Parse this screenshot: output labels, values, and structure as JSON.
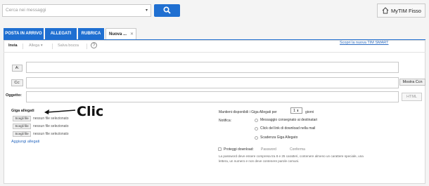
{
  "top": {
    "search_placeholder": "Cerca nei messaggi",
    "mytim_label": "MyTIM Fisso"
  },
  "tabs": [
    {
      "label": "POSTA IN ARRIVO"
    },
    {
      "label": "ALLEGATI"
    },
    {
      "label": "RUBRICA"
    },
    {
      "label": "Nuova ..."
    }
  ],
  "toolbar": {
    "send": "Invia",
    "attach": "Allega ▾",
    "save_draft": "Salva bozza",
    "help": "?",
    "new_smart": "Scopri la nuova TIM SMART"
  },
  "compose": {
    "to_label": "A:",
    "cc_label": "Cc:",
    "show_ccn": "Mostra Ccn",
    "subject_label": "Oggetto:",
    "html_label": "HTML"
  },
  "attachments": {
    "heading": "Giga allegati",
    "rows": [
      {
        "button": "Scegli file",
        "status": "nessun file selezionato"
      },
      {
        "button": "Scegli file",
        "status": "nessun file selezionato"
      },
      {
        "button": "Scegli file",
        "status": "nessun file selezionato"
      }
    ],
    "add_link": "Aggiungi allegati",
    "annotation": "Clic"
  },
  "options": {
    "keep_prefix": "Mantieni disponibili i Giga Allegati per",
    "keep_value": "1",
    "keep_suffix": "giorni",
    "notify_label": "Notifica:",
    "notify_options": [
      "Messaggio consegnato ai destinatari",
      "Click del link di download nella mail",
      "Scadenza Giga Allegato"
    ],
    "protect_label": "Proteggi download:",
    "password_label": "Password",
    "confirm_label": "Conferma",
    "password_hint_1": "La password deve essere compresa tra 8 e 25 caratteri, contenere almeno un carattere speciale, una",
    "password_hint_2": "lettera, un numero e non deve contenere parole comuni."
  }
}
